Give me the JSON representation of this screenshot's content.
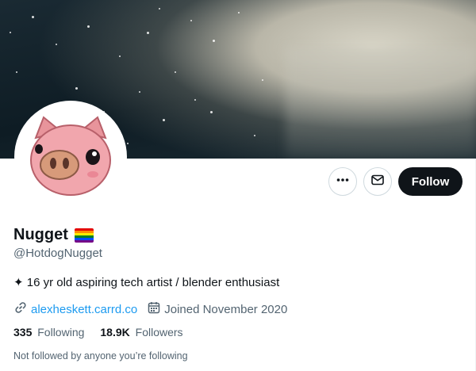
{
  "profile": {
    "display_name": "Nugget",
    "name_emoji": "rainbow-flag-icon",
    "handle": "@HotdogNugget",
    "bio": "✦ 16 yr old aspiring tech artist / blender enthusiast",
    "website": "alexheskett.carrd.co",
    "joined": "Joined November 2020"
  },
  "stats": {
    "following_count": "335",
    "following_label": "Following",
    "followers_count": "18.9K",
    "followers_label": "Followers"
  },
  "followers_note": "Not followed by anyone you’re following",
  "actions": {
    "more_icon": "more-icon",
    "message_icon": "envelope-icon",
    "follow_label": "Follow"
  },
  "colors": {
    "accent_link": "#1d9bf0",
    "follow_button_bg": "#0f1419",
    "secondary_text": "#536471",
    "border": "#cfd9de"
  }
}
